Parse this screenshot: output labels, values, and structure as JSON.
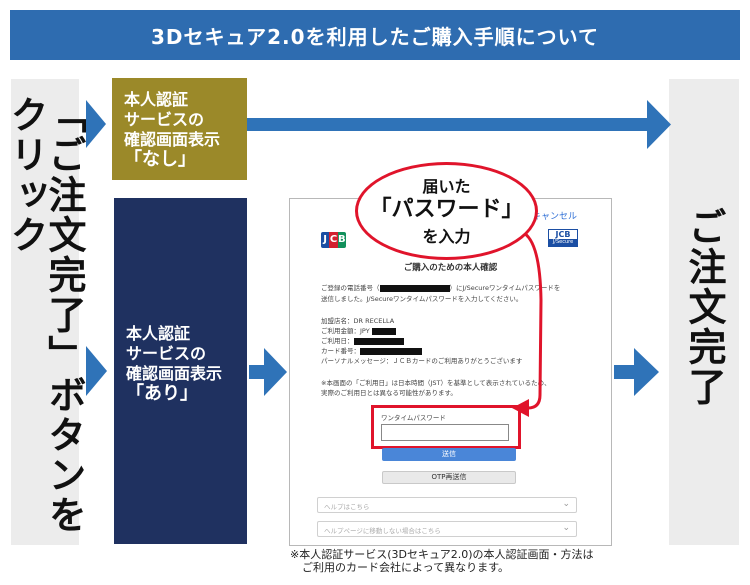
{
  "title": "3Dセキュア2.0を利用したご購入手順について",
  "left_step": "「ご注文完了」ボタンをクリック",
  "right_step": "ご注文完了",
  "branch_none": {
    "line1": "本人認証",
    "line2": "サービスの",
    "line3": "確認画面表示",
    "line4": "「なし」"
  },
  "branch_yes": {
    "line1": "本人認証",
    "line2": "サービスの",
    "line3": "確認画面表示",
    "line4": "「あり」"
  },
  "callout": {
    "line1": "届いた",
    "line2": "「パスワード」",
    "line3": "を入力"
  },
  "screen": {
    "cancel_link": "キャンセル",
    "brand_left": "JCB",
    "brand_right_top": "JCB",
    "brand_right_bottom": "J/Secure",
    "heading": "ご購入のための本人確認",
    "msg_line1_a": "ご登録の電話番号（",
    "msg_line1_b": "）にJ/Secureワンタイムパスワードを",
    "msg_line2": "送信しました。J/Secureワンタイムパスワードを入力してください。",
    "merchant": "加盟店名：DR RECELLA",
    "amount": "ご利用金額：JPY",
    "date": "ご利用日：",
    "card_no": "カード番号：",
    "personal_msg": "パーソナルメッセージ：ＪＣＢカードのご利用ありがとうございます",
    "time_note1": "※本画面の「ご利用日」は日本時間（JST）を基準として表示されているため、",
    "time_note2": "実際のご利用日とは異なる可能性があります。",
    "otp_label": "ワンタイムパスワード",
    "submit_label": "送信",
    "resend_label": "OTP再送信",
    "help1": "ヘルプはこちら",
    "help2": "ヘルプページに移動しない場合はこちら"
  },
  "footnote_line1": "※本人認証サービス(3Dセキュア2.0)の本人認証画面・方法は",
  "footnote_line2": "ご利用のカード会社によって異なります。",
  "colors": {
    "banner": "#2e6cb0",
    "arrow": "#2f73b8",
    "none_box": "#9b8929",
    "yes_box": "#1f3160",
    "highlight": "#e0142b",
    "submit": "#4a86d8"
  }
}
